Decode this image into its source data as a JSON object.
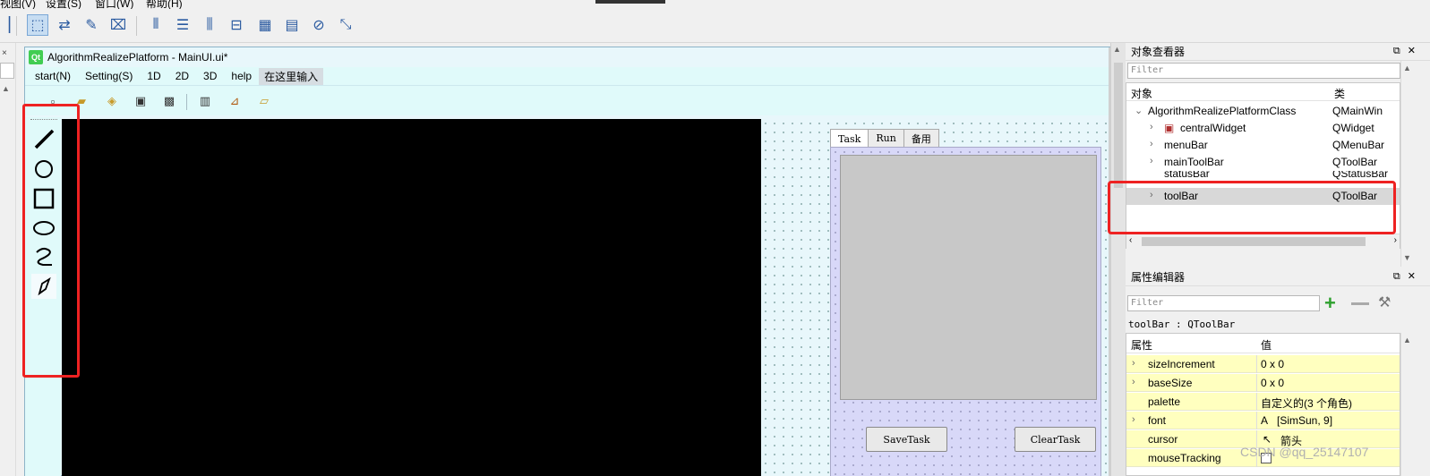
{
  "top_menu": [
    "视图(V)",
    "设置(S)",
    "窗口(W)",
    "帮助(H)"
  ],
  "designer_toolbar_icons": [
    "edit-widgets-icon",
    "edit-signals-icon",
    "edit-buddies-icon",
    "edit-tab-order-icon",
    "layout-horizontal-icon",
    "layout-vertical-icon",
    "layout-hsplitter-icon",
    "layout-vsplitter-icon",
    "layout-grid-icon",
    "layout-form-icon",
    "break-layout-icon",
    "adjust-size-icon"
  ],
  "form_window": {
    "title": "AlgorithmRealizePlatform - MainUI.ui*",
    "menus": [
      "start(N)",
      "Setting(S)",
      "1D",
      "2D",
      "3D",
      "help"
    ],
    "menu_placeholder": "在这里输入",
    "toolbar_icons": [
      "new-file-icon",
      "open-folder-icon",
      "open-image-icon",
      "save-icon",
      "save-as-icon",
      "export-icon",
      "chart-icon",
      "load-folder-icon"
    ],
    "draw_tools": [
      "line-tool-icon",
      "circle-tool-icon",
      "rectangle-tool-icon",
      "ellipse-tool-icon",
      "freehand-tool-icon",
      "polygon-tool-icon"
    ],
    "tabs": [
      "Task",
      "Run",
      "备用"
    ],
    "buttons": {
      "save_task": "SaveTask",
      "clear_task": "ClearTask"
    }
  },
  "object_inspector": {
    "title": "对象查看器",
    "filter_placeholder": "Filter",
    "col_object": "对象",
    "col_class": "类",
    "rows": [
      {
        "name": "AlgorithmRealizePlatformClass",
        "class": "QMainWin"
      },
      {
        "name": "centralWidget",
        "class": "QWidget"
      },
      {
        "name": "menuBar",
        "class": "QMenuBar"
      },
      {
        "name": "mainToolBar",
        "class": "QToolBar"
      },
      {
        "name": "statusBar",
        "class": "QStatusBar"
      },
      {
        "name": "toolBar",
        "class": "QToolBar"
      }
    ]
  },
  "property_editor": {
    "title": "属性编辑器",
    "filter_placeholder": "Filter",
    "context": "toolBar : QToolBar",
    "col_property": "属性",
    "col_value": "值",
    "rows": [
      {
        "name": "sizeIncrement",
        "value": "0 x 0"
      },
      {
        "name": "baseSize",
        "value": "0 x 0"
      },
      {
        "name": "palette",
        "value": "自定义的(3 个角色)"
      },
      {
        "name": "font",
        "value": "[SimSun, 9]"
      },
      {
        "name": "cursor",
        "value": "箭头"
      },
      {
        "name": "mouseTracking",
        "value": ""
      }
    ]
  },
  "watermark": "CSDN @qq_25147107",
  "colors": {
    "highlight": "#ee2222",
    "form_bg": "#e0fafa",
    "prop_row": "#ffffbf"
  }
}
